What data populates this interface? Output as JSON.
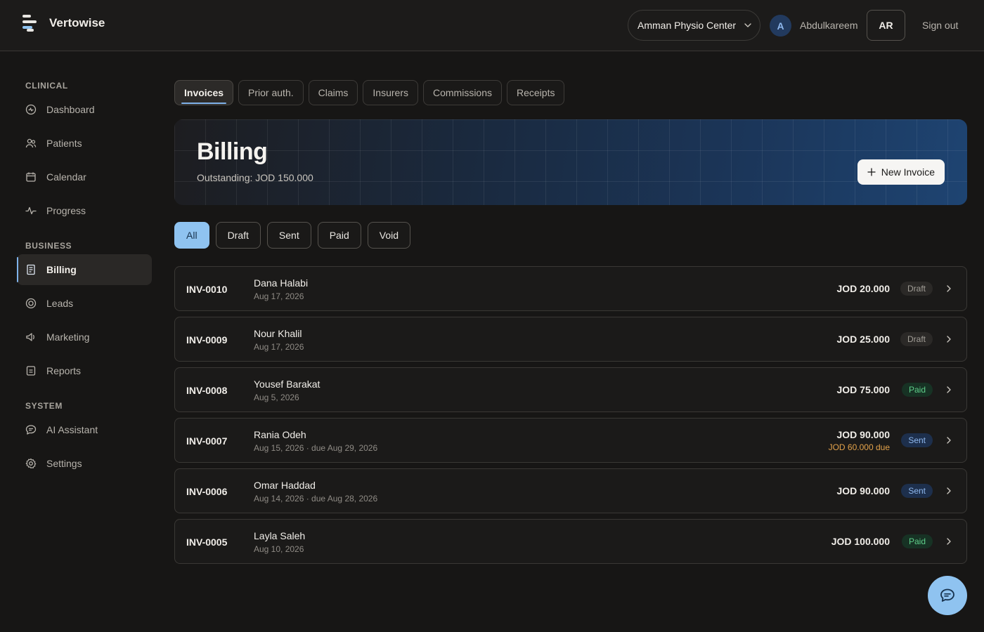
{
  "app": {
    "brand": "Vertowise",
    "clinic": "Amman Physio Center",
    "avatar_initial": "A",
    "username": "Abdulkareem",
    "lang": "AR",
    "sign_out": "Sign out"
  },
  "sidebar": {
    "sections": {
      "clinical": "CLINICAL",
      "business": "BUSINESS",
      "system": "SYSTEM"
    },
    "items": [
      {
        "label": "Dashboard",
        "icon": "dashboard-icon"
      },
      {
        "label": "Patients",
        "icon": "users-icon"
      },
      {
        "label": "Calendar",
        "icon": "calendar-icon"
      },
      {
        "label": "Progress",
        "icon": "activity-icon"
      },
      {
        "label": "Billing",
        "icon": "receipt-icon",
        "active": true
      },
      {
        "label": "Leads",
        "icon": "target-icon"
      },
      {
        "label": "Marketing",
        "icon": "megaphone-icon"
      },
      {
        "label": "Reports",
        "icon": "report-icon"
      },
      {
        "label": "AI Assistant",
        "icon": "chat-icon"
      },
      {
        "label": "Settings",
        "icon": "gear-icon"
      }
    ]
  },
  "tabs": [
    "Invoices",
    "Prior auth.",
    "Claims",
    "Insurers",
    "Commissions",
    "Receipts"
  ],
  "banner": {
    "title": "Billing",
    "subtitle": "Outstanding: JOD 150.000",
    "new_invoice": "New Invoice"
  },
  "filters": [
    "All",
    "Draft",
    "Sent",
    "Paid",
    "Void"
  ],
  "invoices": [
    {
      "id": "INV-0010",
      "name": "Dana Halabi",
      "date": "Aug 17, 2026",
      "amount": "JOD 20.000",
      "due": "",
      "status": "Draft"
    },
    {
      "id": "INV-0009",
      "name": "Nour Khalil",
      "date": "Aug 17, 2026",
      "amount": "JOD 25.000",
      "due": "",
      "status": "Draft"
    },
    {
      "id": "INV-0008",
      "name": "Yousef Barakat",
      "date": "Aug 5, 2026",
      "amount": "JOD 75.000",
      "due": "",
      "status": "Paid"
    },
    {
      "id": "INV-0007",
      "name": "Rania Odeh",
      "date": "Aug 15, 2026 · due Aug 29, 2026",
      "amount": "JOD 90.000",
      "due": "JOD 60.000 due",
      "status": "Sent"
    },
    {
      "id": "INV-0006",
      "name": "Omar Haddad",
      "date": "Aug 14, 2026 · due Aug 28, 2026",
      "amount": "JOD 90.000",
      "due": "",
      "status": "Sent"
    },
    {
      "id": "INV-0005",
      "name": "Layla Saleh",
      "date": "Aug 10, 2026",
      "amount": "JOD 100.000",
      "due": "",
      "status": "Paid"
    }
  ],
  "colors": {
    "accent": "#8fc3f0",
    "paid": "#5fcf8a",
    "sent": "#8fb8ee",
    "due": "#e3a24a"
  }
}
